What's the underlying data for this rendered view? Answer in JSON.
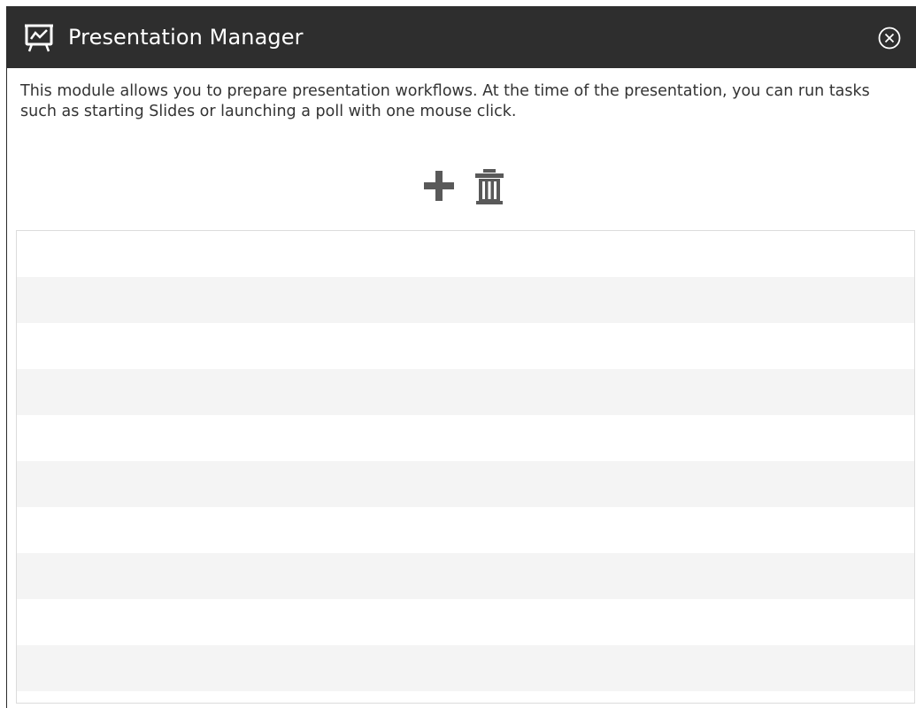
{
  "window": {
    "title": "Presentation Manager",
    "app_icon": "presentation-board-icon",
    "close_icon": "close-circle-icon"
  },
  "description": "This module allows you to prepare presentation workflows. At the time of the presentation, you can run tasks such as starting Slides or launching a poll with one mouse click.",
  "toolbar": {
    "add_icon": "plus-icon",
    "delete_icon": "trash-icon"
  },
  "workflow_list": {
    "items": []
  },
  "colors": {
    "titlebar": "#2e2e2e",
    "title_text": "#ffffff",
    "body_text": "#333333",
    "icon_gray": "#595959",
    "row_alt": "#f4f4f4",
    "list_border": "#dcdcdc"
  }
}
